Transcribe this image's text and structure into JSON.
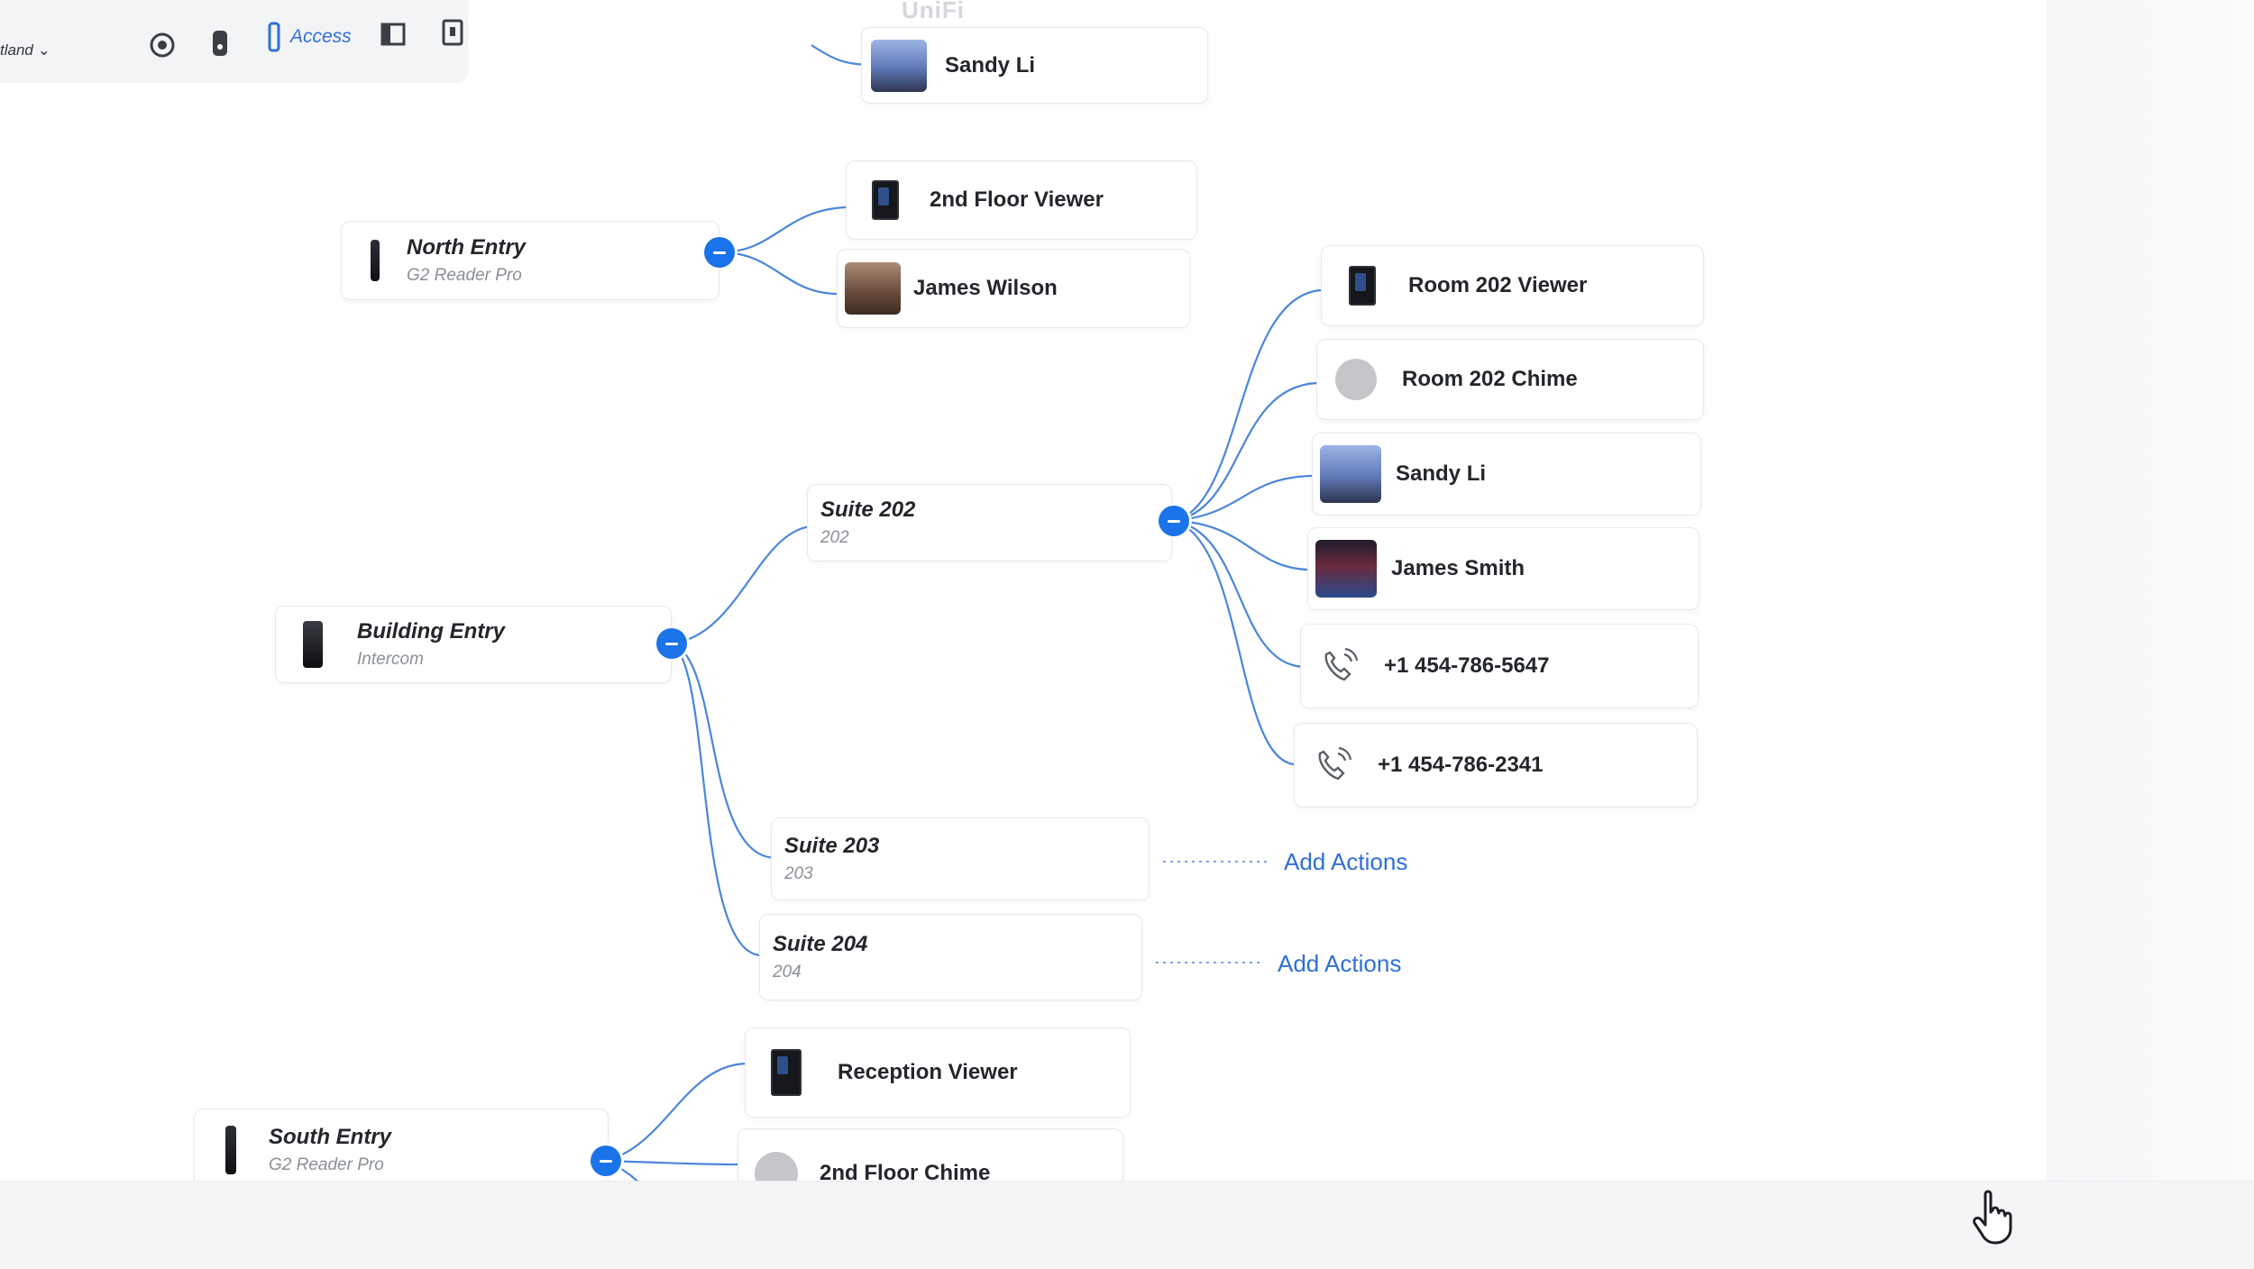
{
  "app": {
    "brand": "UniFi",
    "site": "tland"
  },
  "toolbar": {
    "icons": [
      "camera-icon",
      "doorbell-icon",
      "access-icon",
      "floorplan-icon",
      "intercom-icon"
    ],
    "active_tab": "Access"
  },
  "nodes": {
    "top_partial_person": "Sandy Li",
    "north_entry": {
      "name": "North Entry",
      "sub": "G2 Reader Pro"
    },
    "second_floor_viewer": "2nd Floor Viewer",
    "james_wilson": "James Wilson",
    "room_202_viewer": "Room 202 Viewer",
    "room_202_chime": "Room 202 Chime",
    "sandy_li": "Sandy Li",
    "james_smith": "James Smith",
    "phone_1": "+1 454-786-5647",
    "phone_2": "+1 454-786-2341",
    "suite_202": {
      "name": "Suite 202",
      "sub": "202"
    },
    "building_entry": {
      "name": "Building Entry",
      "sub": "Intercom"
    },
    "suite_203": {
      "name": "Suite 203",
      "sub": "203"
    },
    "suite_204": {
      "name": "Suite 204",
      "sub": "204"
    },
    "reception_viewer": "Reception Viewer",
    "south_entry": {
      "name": "South Entry",
      "sub": "G2 Reader Pro"
    },
    "second_floor_chime": "2nd Floor Chime"
  },
  "actions": {
    "add_actions_label": "Add Actions"
  },
  "colors": {
    "accent": "#1a73e8",
    "link": "#4a86d9",
    "text": "#23262b",
    "muted": "#8b9097"
  }
}
